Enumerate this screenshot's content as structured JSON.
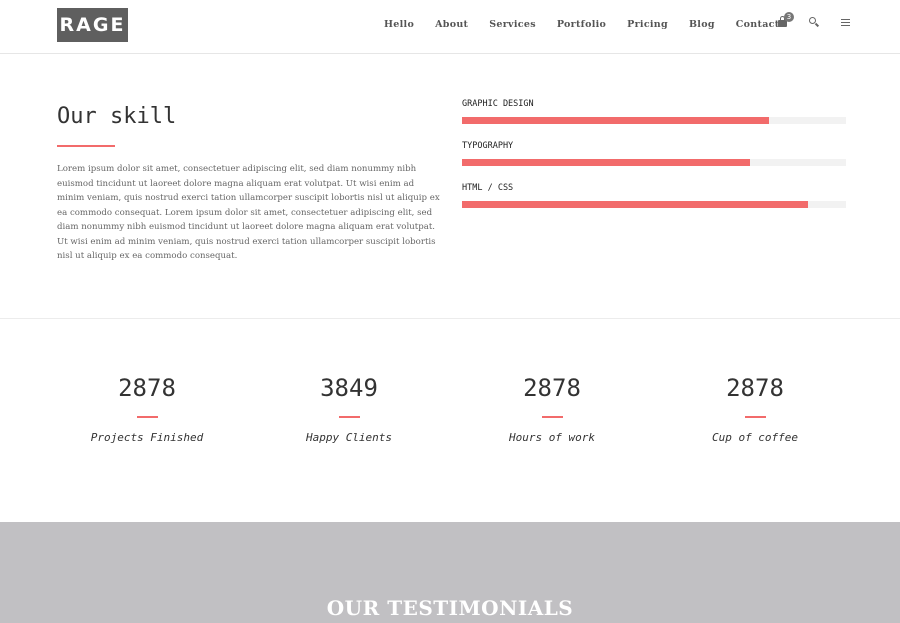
{
  "header": {
    "logo": "RAGE",
    "nav": [
      "Hello",
      "About",
      "Services",
      "Portfolio",
      "Pricing",
      "Blog",
      "Contact"
    ],
    "cart_count": "3",
    "icons": [
      "shopping-bag-icon",
      "search-icon",
      "menu-icon"
    ]
  },
  "skills": {
    "title": "Our skill",
    "text": "Lorem ipsum dolor sit amet, consectetuer adipiscing elit, sed diam nonummy nibh euismod tincidunt ut laoreet dolore magna aliquam erat volutpat. Ut wisi enim ad minim veniam, quis nostrud exerci tation ullamcorper suscipit lobortis nisl ut aliquip ex ea commodo consequat. Lorem ipsum dolor sit amet, consectetuer adipiscing elit, sed diam nonummy nibh euismod tincidunt ut laoreet dolore magna aliquam erat volutpat. Ut wisi enim ad minim veniam, quis nostrud exerci tation ullamcorper suscipit lobortis nisl ut aliquip ex ea commodo consequat.",
    "bars": [
      {
        "label": "GRAPHIC DESIGN",
        "percent": 80
      },
      {
        "label": "TYPOGRAPHY",
        "percent": 75
      },
      {
        "label": "HTML / CSS",
        "percent": 90
      }
    ]
  },
  "stats": [
    {
      "number": "2878",
      "label": "Projects Finished"
    },
    {
      "number": "3849",
      "label": "Happy Clients"
    },
    {
      "number": "2878",
      "label": "Hours of work"
    },
    {
      "number": "2878",
      "label": "Cup of coffee"
    }
  ],
  "testimonials": {
    "title": "OUR TESTIMONIALS"
  },
  "colors": {
    "accent": "#f26b6b",
    "logo_bg": "#5f5f5f",
    "testimonials_bg": "#c1c0c3",
    "bar_track": "#f2f2f2"
  }
}
